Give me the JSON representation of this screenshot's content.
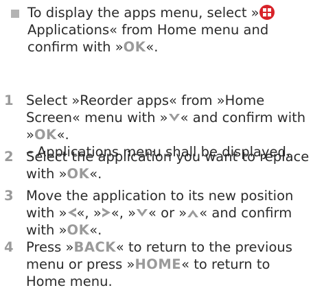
{
  "intro": {
    "pre": "To display the apps menu, select »",
    "post": "Applications« from Home menu and confirm with »",
    "ok": "OK",
    "end": "«."
  },
  "steps": [
    {
      "num": "1",
      "a": "Select »Reorder apps« from »Home Screen« menu with »",
      "b": "« and confirm with »",
      "ok": "OK",
      "c": "«.",
      "sub": "– Applications menu shall be displayed."
    },
    {
      "num": "2",
      "a": "Select the application you want to replace with »",
      "ok": "OK",
      "b": "«."
    },
    {
      "num": "3",
      "a": "Move the application to its new position with »",
      "b": "«, »",
      "c": "«, »",
      "d": "« or »",
      "e": "« and confirm with »",
      "ok": "OK",
      "f": "«."
    },
    {
      "num": "4",
      "a": "Press »",
      "back": "BACK",
      "b": "« to return to the previous menu or press »",
      "home": "HOME",
      "c": "« to return to Home menu."
    }
  ],
  "colors": {
    "text": "#2b2b2b",
    "key": "#9a9a9a",
    "accent": "#d8232a",
    "bullet": "#b3b3b3"
  },
  "icons": {
    "apps": "apps-grid-icon",
    "down": "arrow-down-icon",
    "up": "arrow-up-icon",
    "left": "arrow-left-icon",
    "right": "arrow-right-icon"
  }
}
